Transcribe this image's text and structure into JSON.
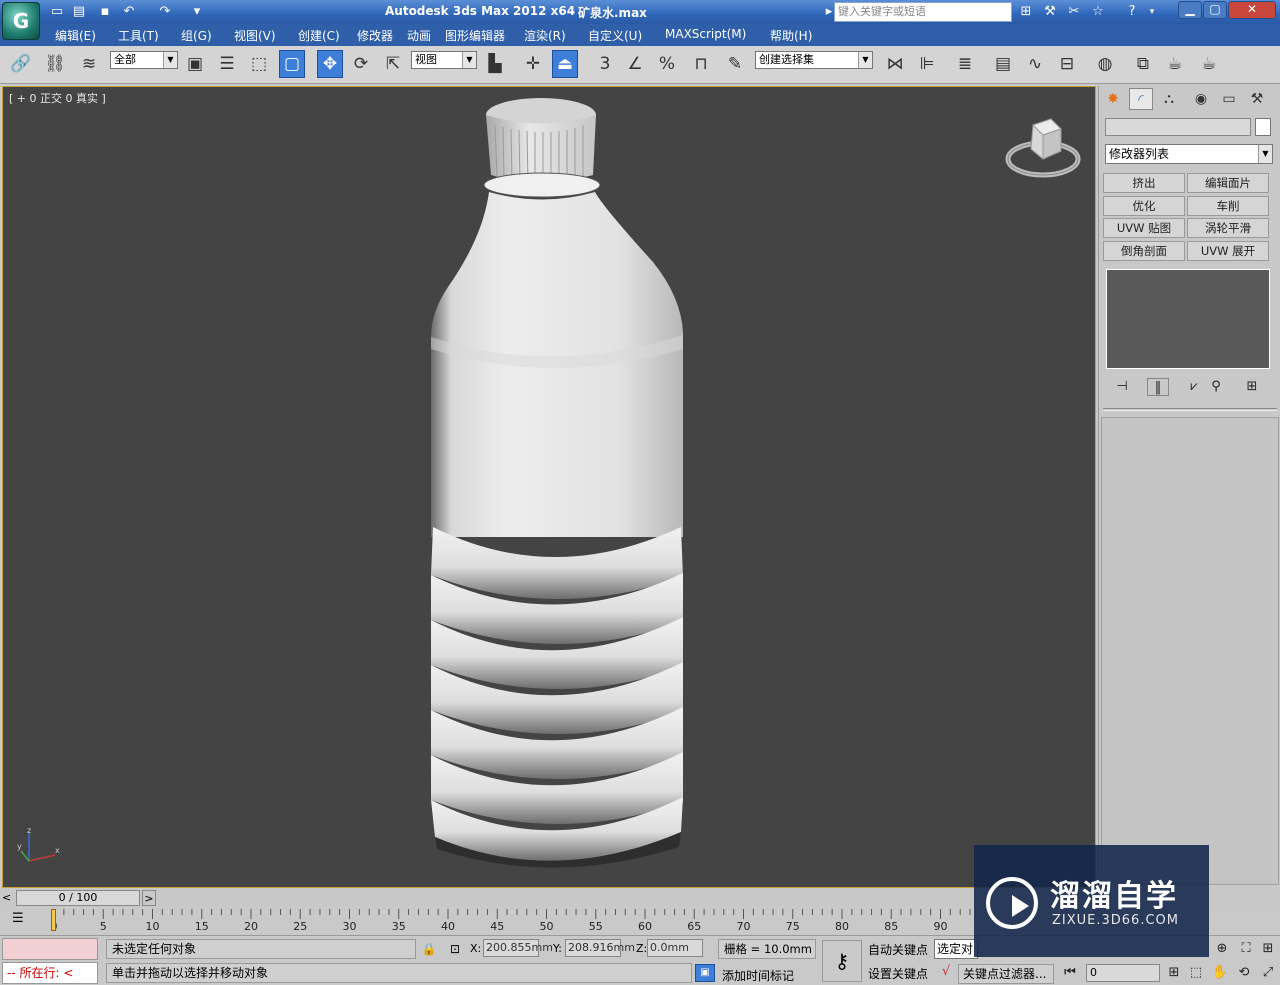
{
  "title": {
    "app": "Autodesk 3ds Max  2012 x64",
    "file": "矿泉水.max",
    "search_placeholder": "键入关键字或短语"
  },
  "menu": [
    "编辑(E)",
    "工具(T)",
    "组(G)",
    "视图(V)",
    "创建(C)",
    "修改器",
    "动画",
    "图形编辑器",
    "渲染(R)",
    "自定义(U)",
    "MAXScript(M)",
    "帮助(H)"
  ],
  "toolbar": {
    "selection_filter": "全部",
    "ref_coord": "视图",
    "named_selection": "创建选择集",
    "snap_3": "3",
    "percent": "%"
  },
  "viewport": {
    "label": "[ + 0 正交 0 真实 ]",
    "axis_z": "z",
    "axis_x": "x",
    "axis_y": "y"
  },
  "command_panel": {
    "modifier_list": "修改器列表",
    "buttons": [
      "挤出",
      "编辑面片",
      "优化",
      "车削",
      "UVW 贴图",
      "涡轮平滑",
      "倒角剖面",
      "UVW 展开"
    ]
  },
  "time_slider": {
    "position": "0 / 100",
    "left": "<",
    "right": ">"
  },
  "track_ticks": [
    "0",
    "5",
    "10",
    "15",
    "20",
    "25",
    "30",
    "35",
    "40",
    "45",
    "50",
    "55",
    "60",
    "65",
    "70",
    "75",
    "80",
    "85",
    "90"
  ],
  "status": {
    "maxscript_prompt": "-- 所在行:  <",
    "selection": "未选定任何对象",
    "prompt": "单击并拖动以选择并移动对象",
    "x_label": "X:",
    "x_value": "200.855mm",
    "y_label": "Y:",
    "y_value": "208.916mm",
    "z_label": "Z:",
    "z_value": "0.0mm",
    "grid": "栅格 = 10.0mm",
    "add_time_tag": "添加时间标记",
    "auto_key": "自动关键点",
    "set_key": "设置关键点",
    "selected_dropdown": "选定对象",
    "key_filters": "关键点过滤器...",
    "frame": "0"
  },
  "watermark": {
    "title": "溜溜自学",
    "url": "ZIXUE.3D66.COM"
  },
  "colors": {
    "menubar": "#2f5fa8",
    "viewport_bg": "#444444",
    "active_border": "#c9a032",
    "watermark_bg": "#12264a"
  }
}
